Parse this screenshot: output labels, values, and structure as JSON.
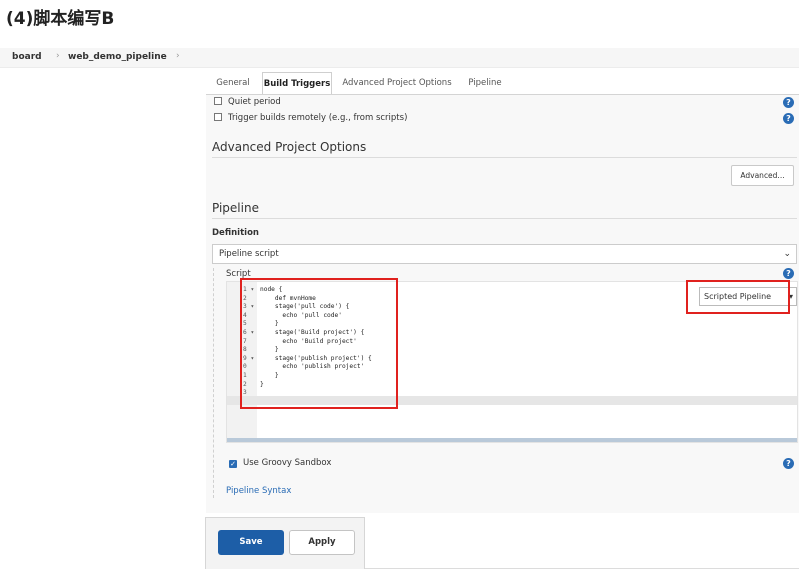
{
  "heading": "(4)脚本编写B",
  "breadcrumb": [
    "board",
    "web_demo_pipeline"
  ],
  "breadcrumb_sep": "›",
  "tabs": [
    "General",
    "Build Triggers",
    "Advanced Project Options",
    "Pipeline"
  ],
  "options": {
    "quiet_period": "Quiet period",
    "trigger_remote": "Trigger builds remotely (e.g., from scripts)"
  },
  "help_glyph": "?",
  "advanced_section": {
    "title": "Advanced Project Options",
    "button": "Advanced..."
  },
  "pipeline_section": {
    "title": "Pipeline",
    "definition_label": "Definition",
    "definition_value": "Pipeline script",
    "script_label": "Script",
    "script_type": "Scripted Pipeline"
  },
  "script_lines": [
    {
      "n": "1",
      "fold": "▾",
      "code": "node {"
    },
    {
      "n": "2",
      "fold": "",
      "code": "    def mvnHome"
    },
    {
      "n": "3",
      "fold": "▾",
      "code": "    stage('pull code') {"
    },
    {
      "n": "4",
      "fold": "",
      "code": "      echo 'pull code'"
    },
    {
      "n": "5",
      "fold": "",
      "code": "    }"
    },
    {
      "n": "6",
      "fold": "▾",
      "code": "    stage('Build project') {"
    },
    {
      "n": "7",
      "fold": "",
      "code": "      echo 'Build project'"
    },
    {
      "n": "8",
      "fold": "",
      "code": "    }"
    },
    {
      "n": "9",
      "fold": "▾",
      "code": "    stage('publish project') {"
    },
    {
      "n": "0",
      "fold": "",
      "code": "      echo 'publish project'"
    },
    {
      "n": "1",
      "fold": "",
      "code": "    }"
    },
    {
      "n": "2",
      "fold": "",
      "code": "}"
    },
    {
      "n": "3",
      "fold": "",
      "code": ""
    }
  ],
  "sandbox_label": "Use Groovy Sandbox",
  "syntax_link": "Pipeline Syntax",
  "buttons": {
    "save": "Save",
    "apply": "Apply"
  },
  "colors": {
    "accent": "#1d5ea7",
    "highlight": "#e0211e",
    "link": "#2a6cb5"
  }
}
